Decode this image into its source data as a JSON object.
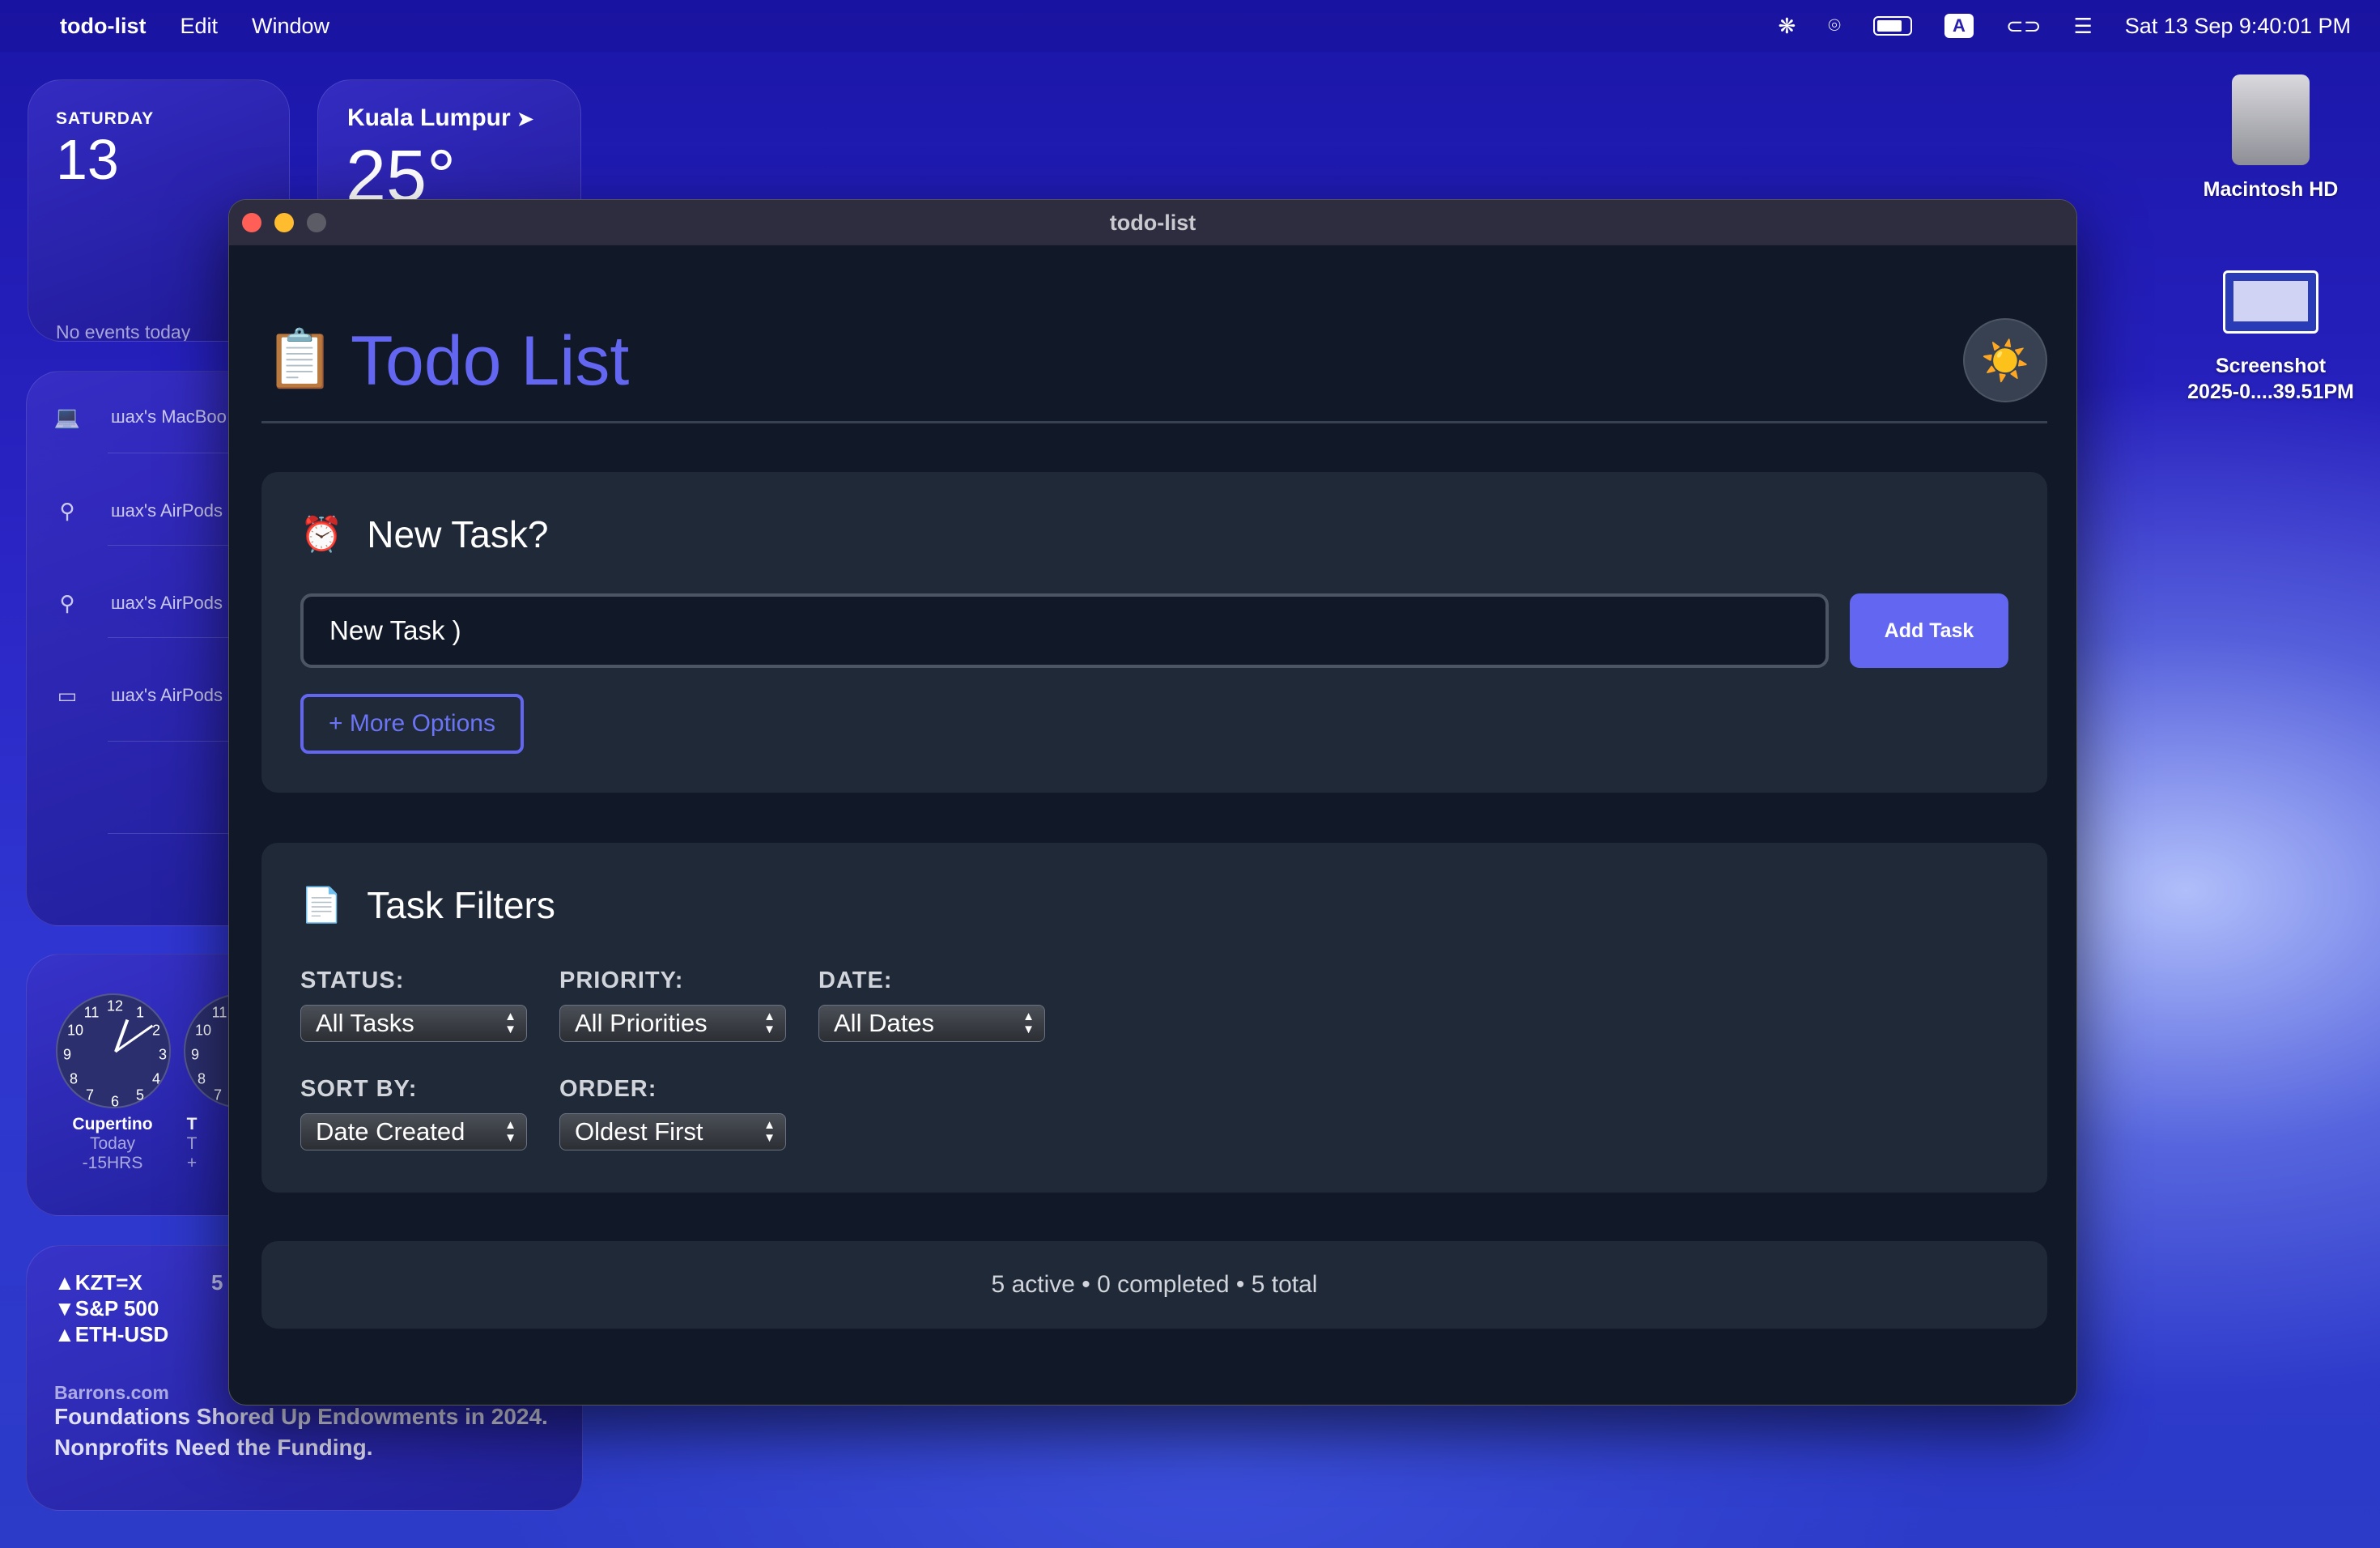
{
  "menubar": {
    "apple": "",
    "app": "todo-list",
    "items": [
      "Edit",
      "Window"
    ],
    "input_source": "A",
    "datetime": "Sat 13 Sep  9:40:01 PM"
  },
  "widgets": {
    "calendar": {
      "day": "SATURDAY",
      "date": "13",
      "events": "No events today"
    },
    "weather": {
      "city": "Kuala Lumpur",
      "temp": "25°"
    },
    "batteries": [
      "шax's MacBoo",
      "шax's AirPods",
      "шax's AirPods",
      "шax's AirPods"
    ],
    "clock": {
      "city": "Cupertino",
      "day": "Today",
      "offset": "-15HRS",
      "city2": "T",
      "day2": "T",
      "offset2": "+"
    },
    "stocks": {
      "rows": [
        "▲KZT=X",
        "▼S&P 500",
        "▲ETH-USD"
      ],
      "value_partial": "5",
      "source": "Barrons.com",
      "headline": "Foundations Shored Up Endowments in 2024. Nonprofits Need the Funding."
    }
  },
  "desktop": {
    "icons": [
      {
        "label": "Macintosh HD"
      },
      {
        "label": "Screenshot\n2025-0....39.51PM"
      }
    ]
  },
  "window": {
    "title": "todo-list",
    "app_title": "Todo List",
    "clip_icon": "📋",
    "theme_icon": "☀️",
    "new_task": {
      "heading": "New Task?",
      "icon": "⏰",
      "input_value": "New Task )",
      "add_label": "Add Task",
      "more_label": "+ More Options"
    },
    "filters": {
      "heading": "Task Filters",
      "icon": "📄",
      "status_label": "STATUS:",
      "status_value": "All Tasks",
      "priority_label": "PRIORITY:",
      "priority_value": "All Priorities",
      "date_label": "DATE:",
      "date_value": "All Dates",
      "sort_label": "SORT BY:",
      "sort_value": "Date Created",
      "order_label": "ORDER:",
      "order_value": "Oldest First"
    },
    "stats": "5 active • 0 completed • 5 total"
  },
  "colors": {
    "accent": "#6366f1",
    "bg": "#111827",
    "card": "#1f2937"
  }
}
